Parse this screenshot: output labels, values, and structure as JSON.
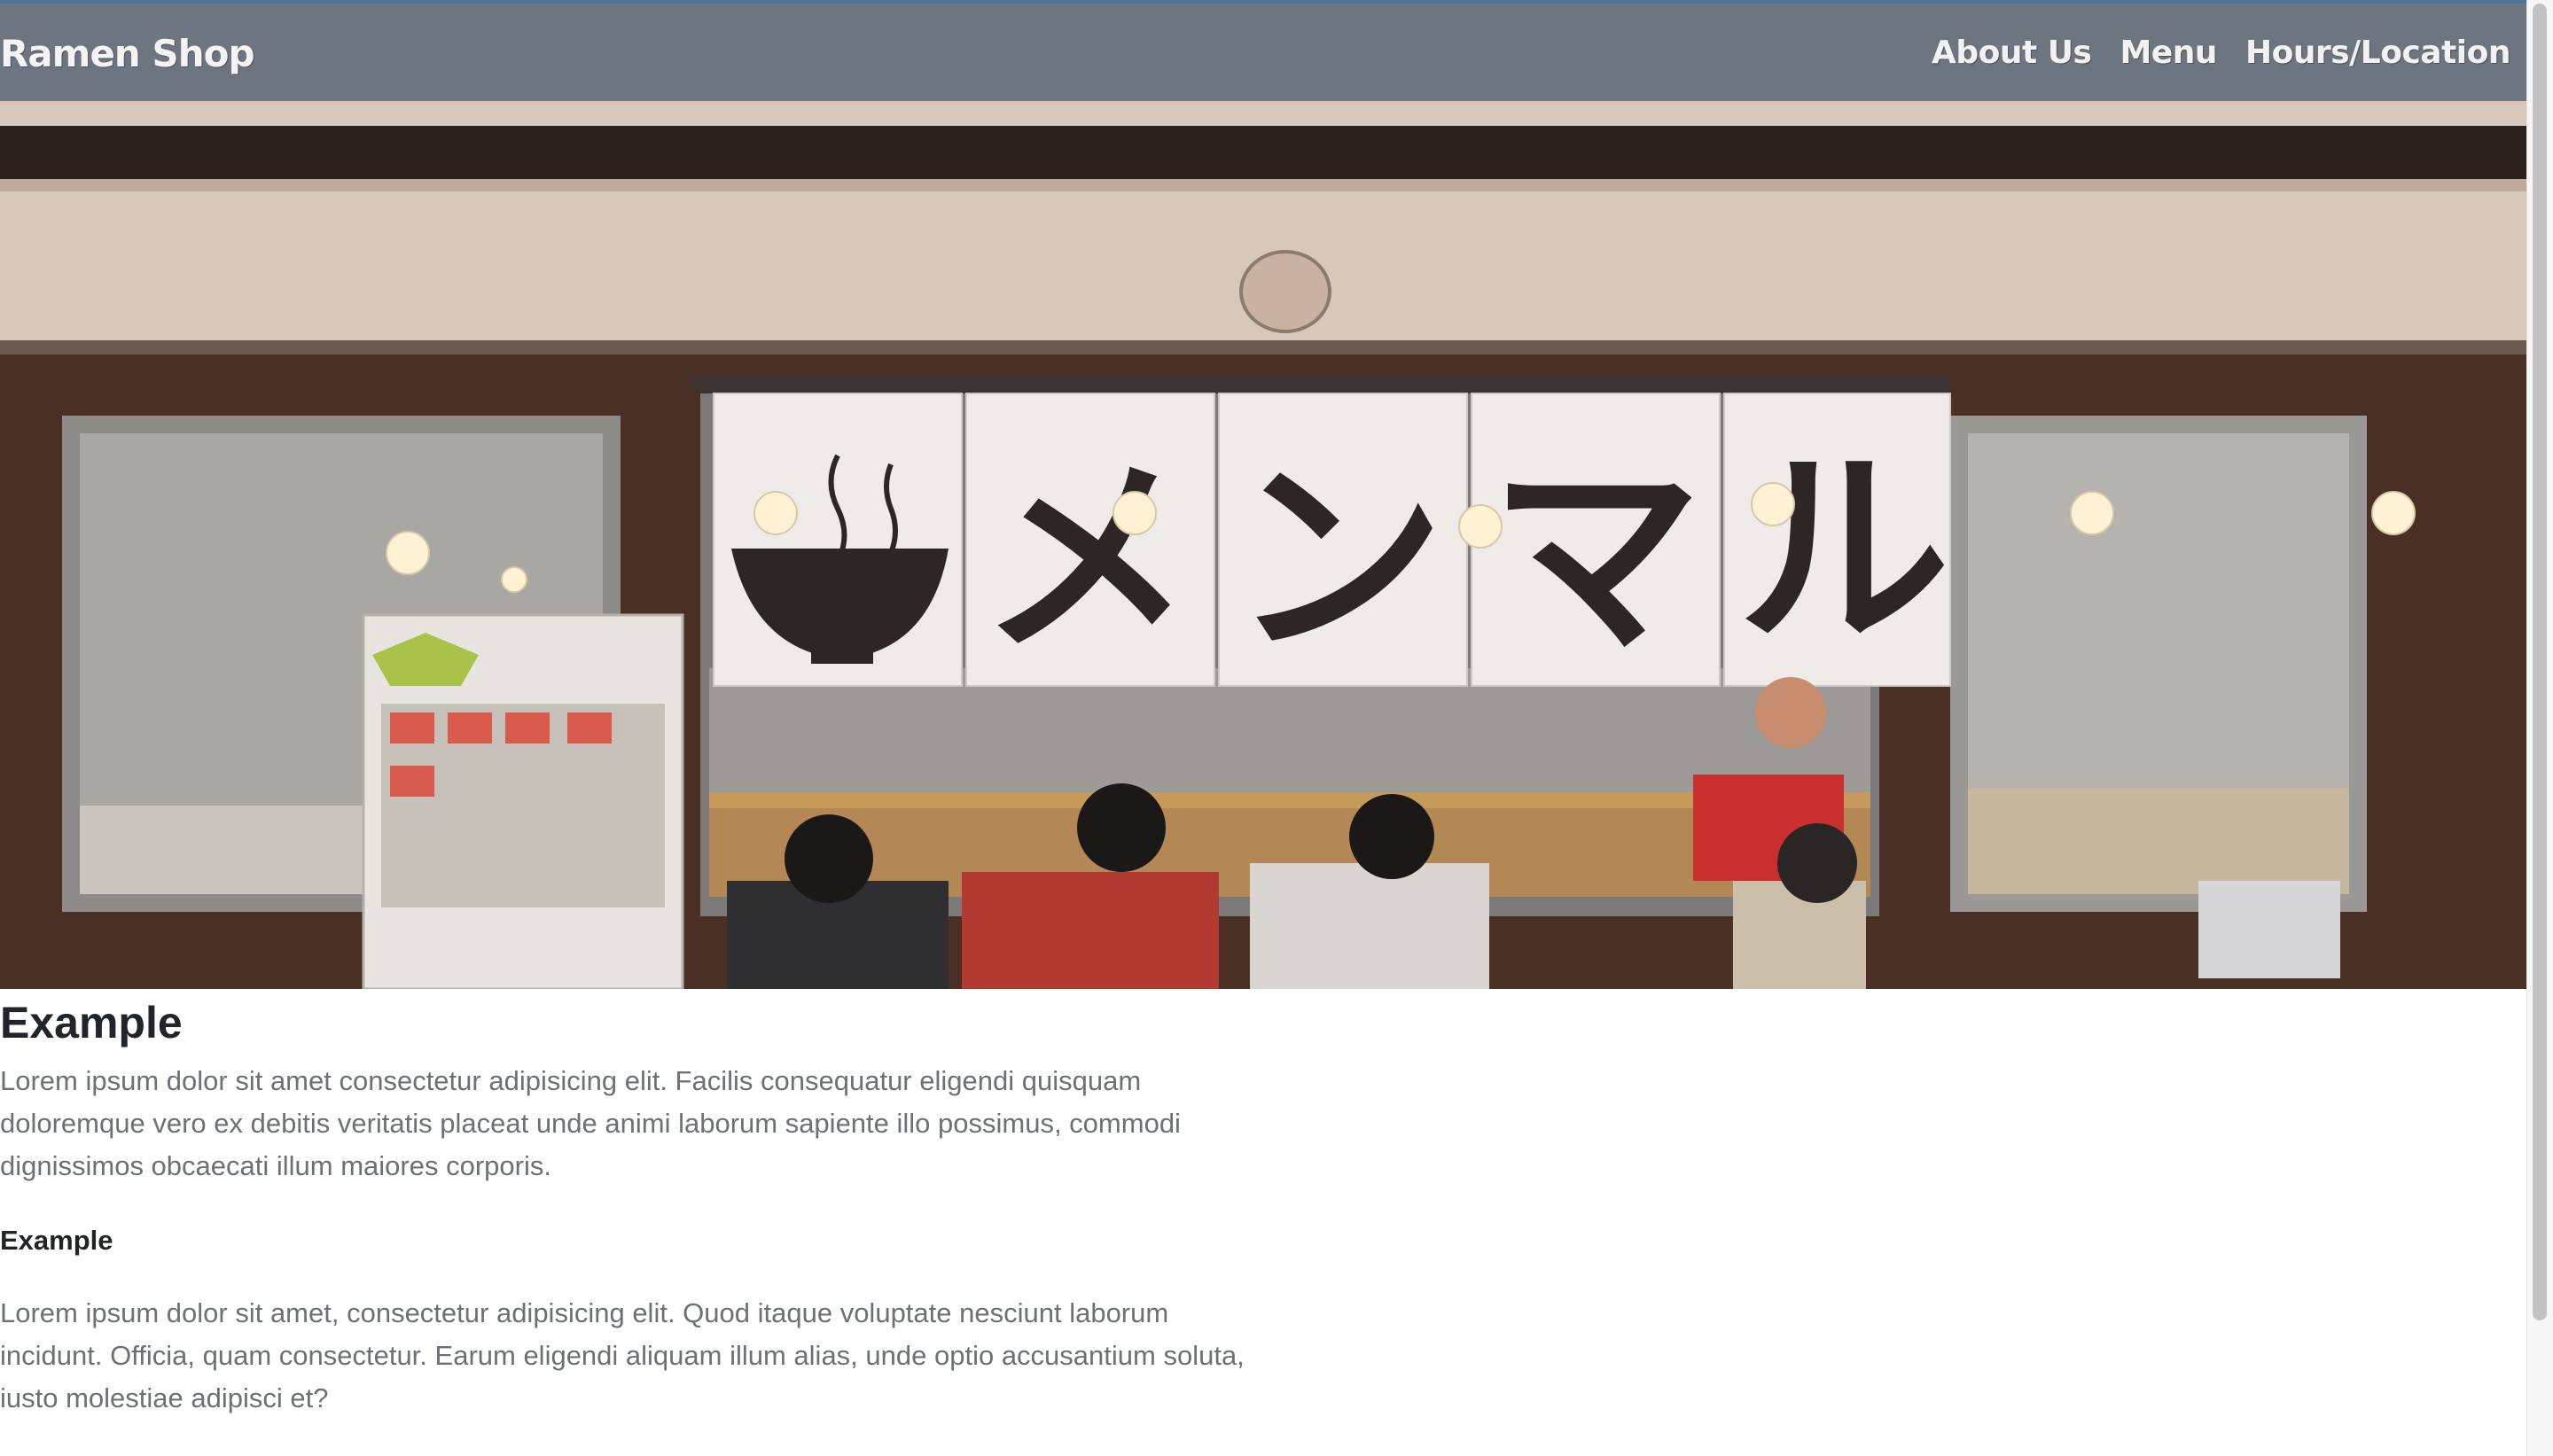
{
  "navbar": {
    "brand": "Ramen Shop",
    "links": [
      "About Us",
      "Menu",
      "Hours/Location"
    ]
  },
  "hero": {
    "image": "ramen-shop-storefront",
    "noren_text": "メンマル"
  },
  "content": {
    "heading": "Example",
    "paragraph1": "Lorem ipsum dolor sit amet consectetur adipisicing elit. Facilis consequatur eligendi quisquam doloremque vero ex debitis veritatis placeat unde animi laborum sapiente illo possimus, commodi dignissimos obcaecati illum maiores corporis.",
    "subheading": "Example",
    "paragraph2": "Lorem ipsum dolor sit amet, consectetur adipisicing elit. Quod itaque voluptate nesciunt laborum incidunt. Officia, quam consectetur. Earum eligendi aliquam illum alias, unde optio accusantium soluta, iusto molestiae adipisci et?"
  },
  "colors": {
    "navbar": "#6d7580",
    "accent_line": "#55749a",
    "heading": "#212529",
    "body_text": "#6b7079"
  }
}
